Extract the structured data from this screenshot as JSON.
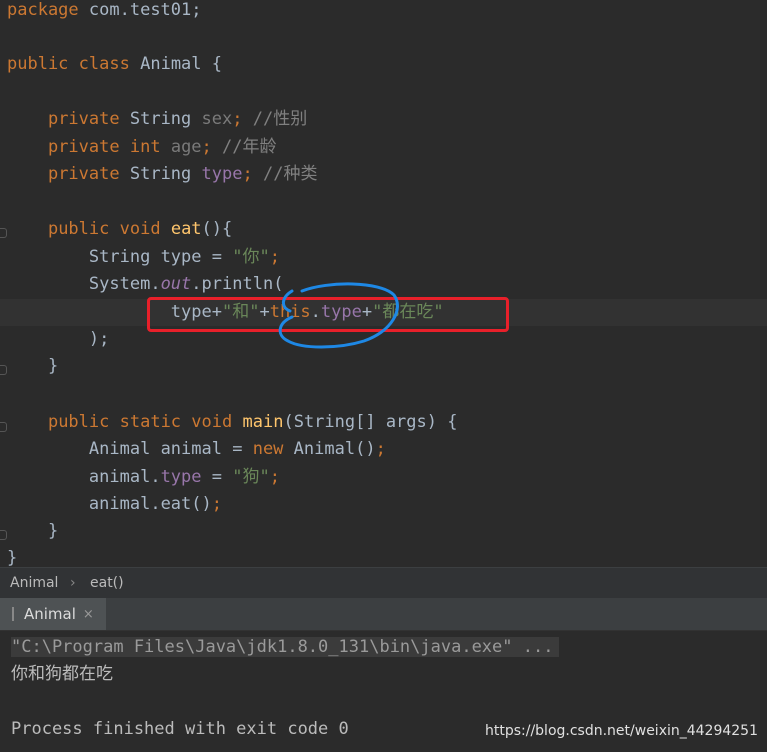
{
  "code": {
    "package_kw": "package",
    "package_name": "com.test01;",
    "public": "public",
    "class": "class",
    "class_name": "Animal",
    "private": "private",
    "string": "String",
    "int": "int",
    "void": "void",
    "static": "static",
    "new": "new",
    "this": "this",
    "field_sex": "sex",
    "field_age": "age",
    "field_type": "type",
    "comment_sex": "//性别",
    "comment_age": "//年龄",
    "comment_type": "//种类",
    "method_eat": "eat",
    "method_main": "main",
    "str_you": "\"你\"",
    "str_and": "\"和\"",
    "str_eating": "\"都在吃\"",
    "str_dog": "\"狗\"",
    "var_type": "type",
    "system": "System",
    "out": "out",
    "println": "println",
    "main_params": "String[] args",
    "var_animal": "animal",
    "open_brace": "{",
    "close_brace": "}"
  },
  "breadcrumb": {
    "class": "Animal",
    "method": "eat()"
  },
  "run_tab": {
    "label": "Animal",
    "close": "×"
  },
  "console": {
    "command": "\"C:\\Program Files\\Java\\jdk1.8.0_131\\bin\\java.exe\" ...",
    "output": "你和狗都在吃",
    "exit": "Process finished with exit code 0"
  },
  "watermark": "https://blog.csdn.net/weixin_44294251",
  "colors": {
    "editor_bg": "#2b2b2b",
    "keyword": "#cc7832",
    "string": "#6a8759",
    "field": "#9876aa",
    "annotation_red": "#e8202a",
    "annotation_blue": "#1e88e5"
  }
}
